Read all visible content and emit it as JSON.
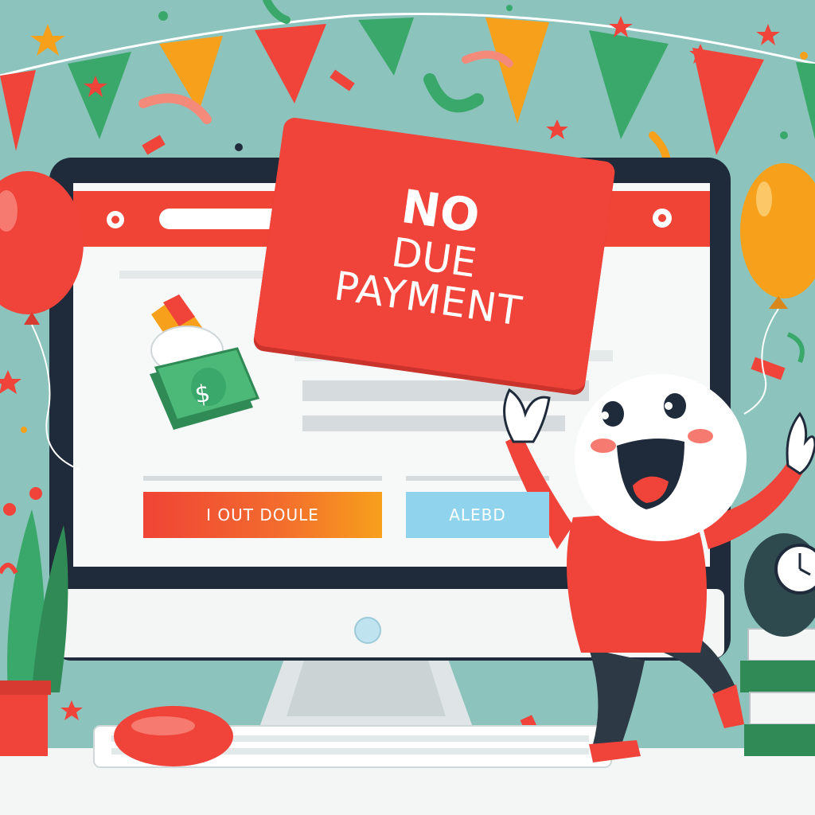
{
  "banner": {
    "line1": "NO",
    "line2": "DUE",
    "line3": "PAYMENT"
  },
  "screen": {
    "primary_button": "I OUT DOULE",
    "secondary_button": "ALEBD"
  },
  "money_icon_symbol": "$",
  "colors": {
    "background": "#8cc4bd",
    "accent_red": "#f0443a",
    "orange": "#f7a01c",
    "green": "#3aa86b",
    "light_blue": "#8fd3ec",
    "monitor_dark": "#1f2a3a"
  },
  "icons": [
    "balloon-red",
    "balloon-orange",
    "bunting-flags",
    "confetti",
    "money-stack-icon",
    "cactus-plant",
    "mouse",
    "keyboard",
    "books-stack",
    "clock",
    "happy-character"
  ]
}
